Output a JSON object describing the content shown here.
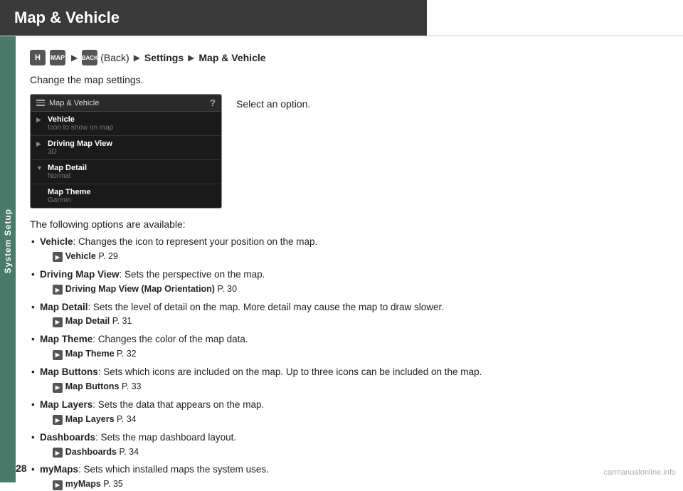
{
  "header": {
    "title": "Map & Vehicle",
    "bg_color": "#3a3a3a"
  },
  "sidebar": {
    "label": "System Setup",
    "bg_color": "#4a7a6a"
  },
  "breadcrumb": {
    "home_icon": "H",
    "map_icon": "MAP",
    "back_icon": "BACK",
    "back_label": "(Back)",
    "arrow": "▶",
    "settings": "Settings",
    "current": "Map & Vehicle"
  },
  "description": "Change the map settings.",
  "select_option": "Select an option.",
  "screen": {
    "title": "Map & Vehicle",
    "items": [
      {
        "label": "Vehicle",
        "sub": "Icon to show on map",
        "arrow": "right"
      },
      {
        "label": "Driving Map View",
        "sub": "3D",
        "arrow": "right"
      },
      {
        "label": "Map Detail",
        "sub": "Normal",
        "arrow": "down"
      },
      {
        "label": "Map Theme",
        "sub": "Garmin",
        "arrow": null
      }
    ]
  },
  "options_intro": "The following options are available:",
  "options": [
    {
      "name": "Vehicle",
      "desc": "Changes the icon to represent your position on the map.",
      "ref_label": "Vehicle",
      "ref_page": "P. 29"
    },
    {
      "name": "Driving Map View",
      "desc": "Sets the perspective on the map.",
      "ref_label": "Driving Map View (Map Orientation)",
      "ref_page": "P. 30"
    },
    {
      "name": "Map Detail",
      "desc": "Sets the level of detail on the map. More detail may cause the map to draw slower.",
      "ref_label": "Map Detail",
      "ref_page": "P. 31"
    },
    {
      "name": "Map Theme",
      "desc": "Changes the color of the map data.",
      "ref_label": "Map Theme",
      "ref_page": "P. 32"
    },
    {
      "name": "Map Buttons",
      "desc": "Sets which icons are included on the map. Up to three icons can be included on the map.",
      "ref_label": "Map Buttons",
      "ref_page": "P. 33"
    },
    {
      "name": "Map Layers",
      "desc": "Sets the data that appears on the map.",
      "ref_label": "Map Layers",
      "ref_page": "P. 34"
    },
    {
      "name": "Dashboards",
      "desc": "Sets the map dashboard layout.",
      "ref_label": "Dashboards",
      "ref_page": "P. 34"
    },
    {
      "name": "myMaps",
      "desc": "Sets which installed maps the system uses.",
      "ref_label": "myMaps",
      "ref_page": "P. 35"
    }
  ],
  "page_number": "28",
  "watermark": "carmanualonline.info"
}
